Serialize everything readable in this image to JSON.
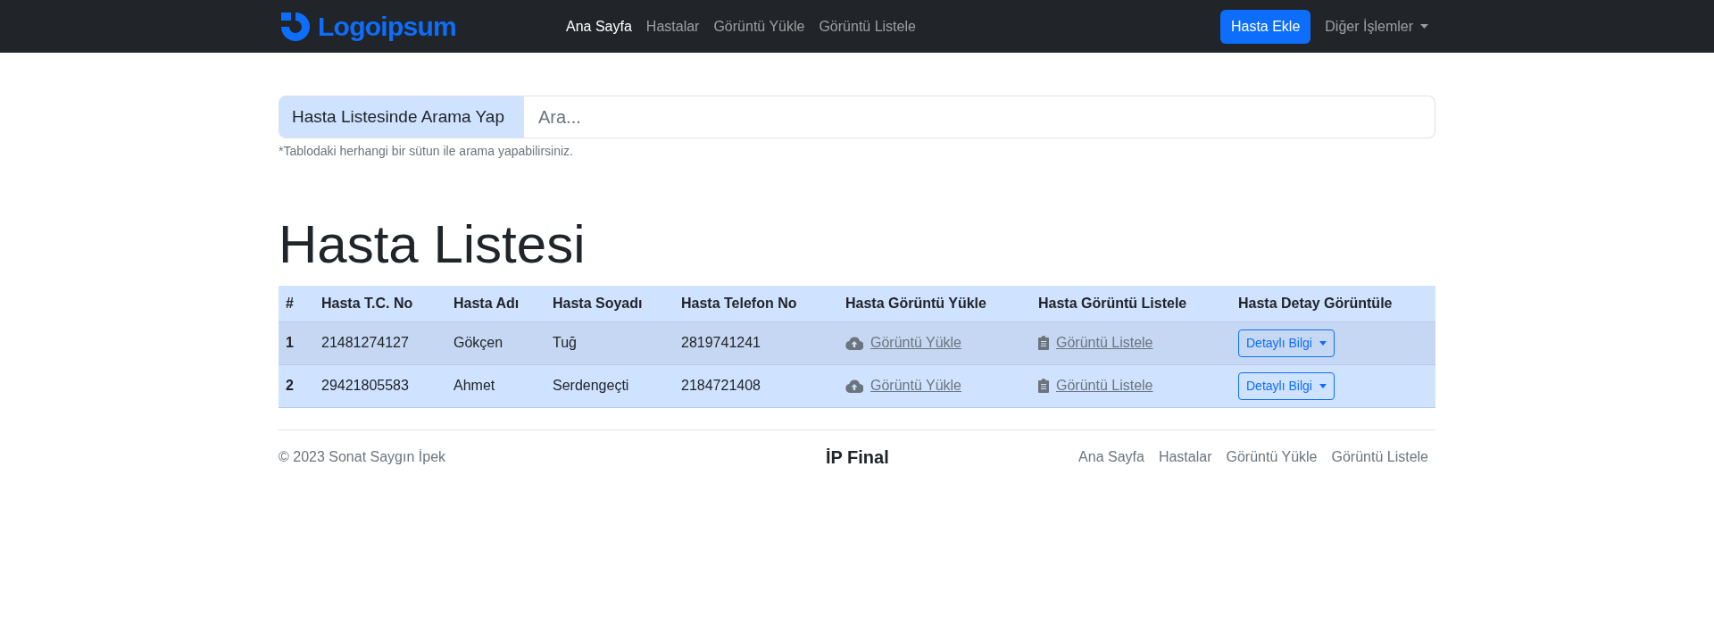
{
  "navbar": {
    "brand": "Logoipsum",
    "links": [
      {
        "label": "Ana Sayfa",
        "selected": true
      },
      {
        "label": "Hastalar",
        "selected": false
      },
      {
        "label": "Görüntü Yükle",
        "selected": false
      },
      {
        "label": "Görüntü Listele",
        "selected": false
      }
    ],
    "button": "Hasta Ekle",
    "dropdown": "Diğer İşlemler"
  },
  "search": {
    "label": "Hasta Listesinde Arama Yap",
    "placeholder": "Ara...",
    "help": "*Tablodaki herhangi bir sütun ile arama yapabilirsiniz."
  },
  "heading": "Hasta Listesi",
  "table": {
    "columns": [
      "#",
      "Hasta T.C. No",
      "Hasta Adı",
      "Hasta Soyadı",
      "Hasta Telefon No",
      "Hasta Görüntü Yükle",
      "Hasta Görüntü Listele",
      "Hasta Detay Görüntüle"
    ],
    "rows": [
      {
        "index": "1",
        "tc": "21481274127",
        "name": "Gökçen",
        "surname": "Tuğ",
        "phone": "2819741241",
        "upload": "Görüntü Yükle",
        "list": "Görüntü Listele",
        "detail": "Detaylı Bilgi"
      },
      {
        "index": "2",
        "tc": "29421805583",
        "name": "Ahmet",
        "surname": "Serdengeçti",
        "phone": "2184721408",
        "upload": "Görüntü Yükle",
        "list": "Görüntü Listele",
        "detail": "Detaylı Bilgi"
      }
    ]
  },
  "footer": {
    "copyright": "© 2023 Sonat Saygın İpek",
    "center": "İP Final",
    "links": [
      "Ana Sayfa",
      "Hastalar",
      "Görüntü Yükle",
      "Görüntü Listele"
    ]
  }
}
